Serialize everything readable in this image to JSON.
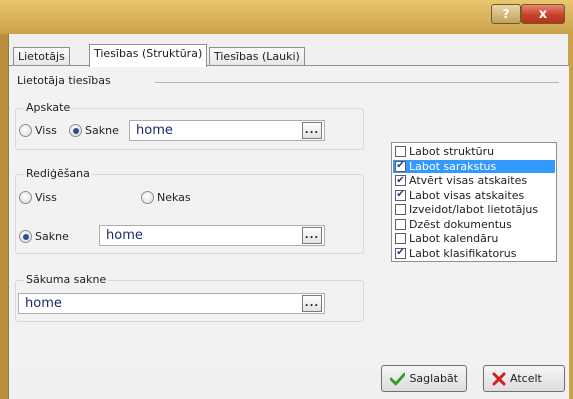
{
  "titlebar": {
    "help_label": "?",
    "close_label": "x"
  },
  "tabs": [
    {
      "label": "Lietotājs"
    },
    {
      "label": "Tiesības (Struktūra)"
    },
    {
      "label": "Tiesības (Lauki)"
    }
  ],
  "panel": {
    "group_caption": "Lietotāja tiesības",
    "apskate": {
      "legend": "Apskate",
      "option_all": "Viss",
      "option_root": "Sakne",
      "selected": "Sakne",
      "path_value": "home",
      "browse_label": "..."
    },
    "redigesana": {
      "legend": "Rediģēšana",
      "option_all": "Viss",
      "option_none": "Nekas",
      "option_root": "Sakne",
      "selected": "Sakne",
      "path_value": "home",
      "browse_label": "..."
    },
    "sakuma_sakne": {
      "legend": "Sākuma sakne",
      "path_value": "home",
      "browse_label": "..."
    },
    "permissions": [
      {
        "label": "Labot struktūru",
        "checked": false,
        "selected": false
      },
      {
        "label": "Labot sarakstus",
        "checked": true,
        "selected": true
      },
      {
        "label": "Atvērt visas atskaites",
        "checked": true,
        "selected": false
      },
      {
        "label": "Labot visas atskaites",
        "checked": true,
        "selected": false
      },
      {
        "label": "Izveidot/labot lietotājus",
        "checked": false,
        "selected": false
      },
      {
        "label": "Dzēst dokumentus",
        "checked": false,
        "selected": false
      },
      {
        "label": "Labot kalendāru",
        "checked": false,
        "selected": false
      },
      {
        "label": "Labot klasifikatorus",
        "checked": true,
        "selected": false
      }
    ]
  },
  "buttons": {
    "save_label": "Saglabāt",
    "cancel_label": "Atcelt"
  },
  "colors": {
    "selection": "#3399ff",
    "check_mark": "#1f3f8f",
    "save_icon": "#2e9e2e",
    "cancel_icon": "#d02020"
  }
}
